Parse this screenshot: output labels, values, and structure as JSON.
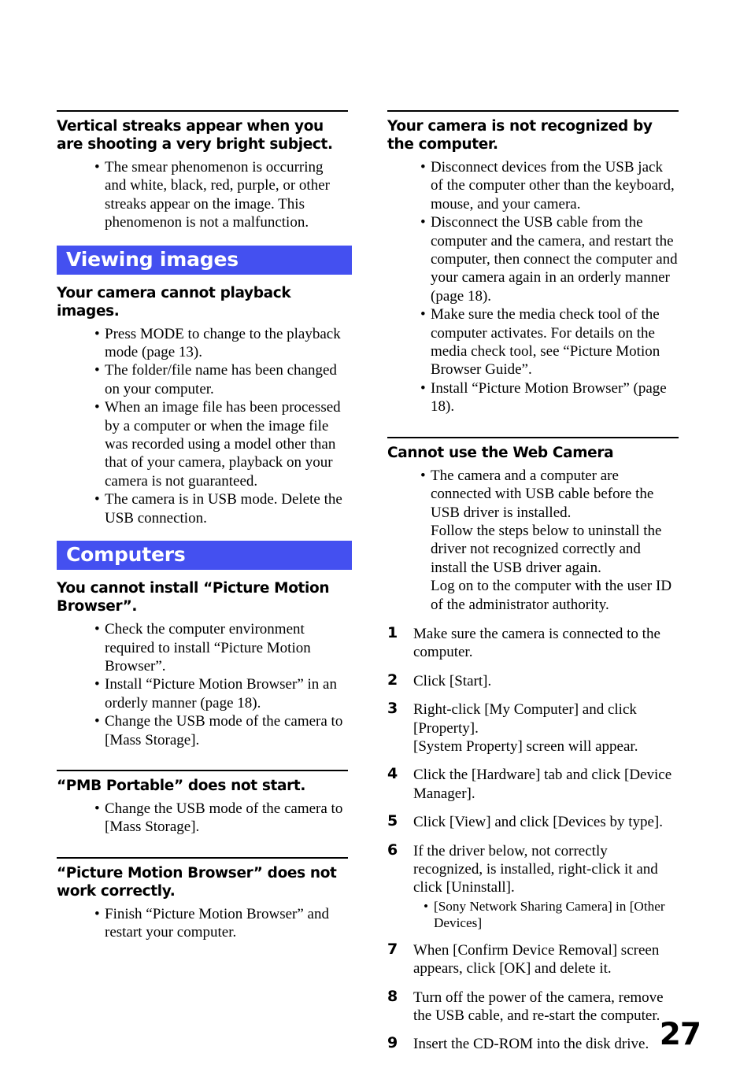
{
  "page": {
    "number": "27",
    "accent_color": "#4450f0",
    "text_color": "#000000",
    "background_color": "#ffffff"
  },
  "left_column": {
    "block_1": {
      "heading": "Vertical streaks appear when you are shooting a very bright subject.",
      "bullets": [
        "The smear phenomenon is occurring and white, black, red, purple, or other streaks appear on the image. This phenomenon is not a malfunction."
      ]
    },
    "section_viewing_images": {
      "band_label": "Viewing images",
      "block_1": {
        "heading": "Your camera cannot playback images.",
        "bullets": [
          "Press MODE to change to the playback mode (page 13).",
          "The folder/file name has been changed on your computer.",
          "When an image file has been processed by a computer or when the image file was recorded using a model other than that of your camera, playback on your camera is not guaranteed.",
          "The camera is in USB mode. Delete the USB connection."
        ]
      }
    },
    "section_computers": {
      "band_label": "Computers",
      "block_1": {
        "heading": "You cannot install “Picture Motion Browser”.",
        "bullets": [
          "Check the computer environment required to install “Picture Motion Browser”.",
          "Install “Picture Motion Browser” in an orderly manner (page 18).",
          "Change the USB mode of the camera to [Mass Storage]."
        ]
      },
      "block_2": {
        "heading": "“PMB Portable” does not start.",
        "bullets": [
          "Change the USB mode of the camera to [Mass Storage]."
        ]
      },
      "block_3": {
        "heading": "“Picture Motion Browser” does not work correctly.",
        "bullets": [
          "Finish “Picture Motion Browser” and restart your computer."
        ]
      }
    }
  },
  "right_column": {
    "block_1": {
      "heading": "Your camera is not recognized by the computer.",
      "bullets": [
        "Disconnect devices from the USB jack of the computer other than the keyboard, mouse, and your camera.",
        "Disconnect the USB cable from the computer and the camera, and restart the computer, then connect the computer and your camera again in an orderly manner (page 18).",
        "Make sure the media check tool of the computer activates. For details on the media check tool, see “Picture Motion Browser Guide”.",
        "Install “Picture Motion Browser” (page 18)."
      ]
    },
    "block_2": {
      "heading": "Cannot use the Web Camera",
      "bullets": [
        "The camera and a computer are connected with USB cable before the USB driver is installed.\nFollow the steps below to uninstall the driver not recognized correctly and install the USB driver again.\nLog on to the computer with the user ID of the administrator authority."
      ],
      "steps": [
        {
          "number": "1",
          "lines": [
            "Make sure the camera is connected to the computer."
          ]
        },
        {
          "number": "2",
          "lines": [
            "Click [Start]."
          ]
        },
        {
          "number": "3",
          "lines": [
            "Right-click [My Computer] and click [Property].",
            "[System Property] screen will appear."
          ]
        },
        {
          "number": "4",
          "lines": [
            "Click the [Hardware] tab and click [Device Manager]."
          ]
        },
        {
          "number": "5",
          "lines": [
            "Click [View] and click [Devices by type]."
          ]
        },
        {
          "number": "6",
          "lines": [
            "If the driver below, not correctly recognized, is installed, right-click it and click [Uninstall]."
          ],
          "subbullets": [
            "[Sony Network Sharing Camera] in [Other Devices]"
          ]
        },
        {
          "number": "7",
          "lines": [
            "When [Confirm Device Removal] screen appears, click [OK] and delete it."
          ]
        },
        {
          "number": "8",
          "lines": [
            "Turn off the power of the camera, remove the USB cable, and re-start the computer."
          ]
        },
        {
          "number": "9",
          "lines": [
            "Insert the CD-ROM into the disk drive."
          ]
        }
      ]
    }
  }
}
